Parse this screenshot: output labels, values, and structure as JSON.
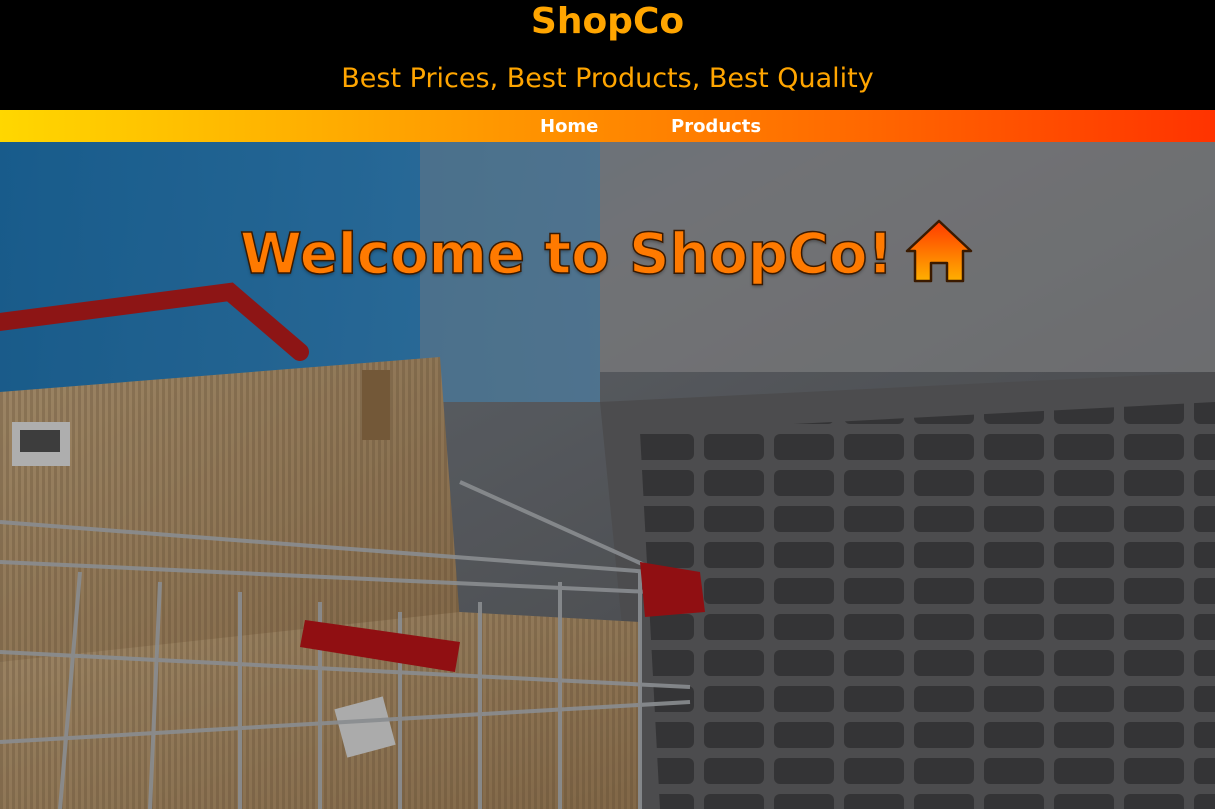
{
  "header": {
    "brand": "ShopCo",
    "tagline": "Best Prices, Best Products, Best Quality"
  },
  "nav": {
    "items": [
      {
        "label": "Home"
      },
      {
        "label": "Products"
      }
    ]
  },
  "hero": {
    "welcome": "Welcome to ShopCo!",
    "icon": "home-icon"
  },
  "colors": {
    "brand": "#FFA500",
    "welcome": "#FF7A00",
    "nav_gradient_start": "#FFD700",
    "nav_gradient_end": "#FF3300"
  }
}
